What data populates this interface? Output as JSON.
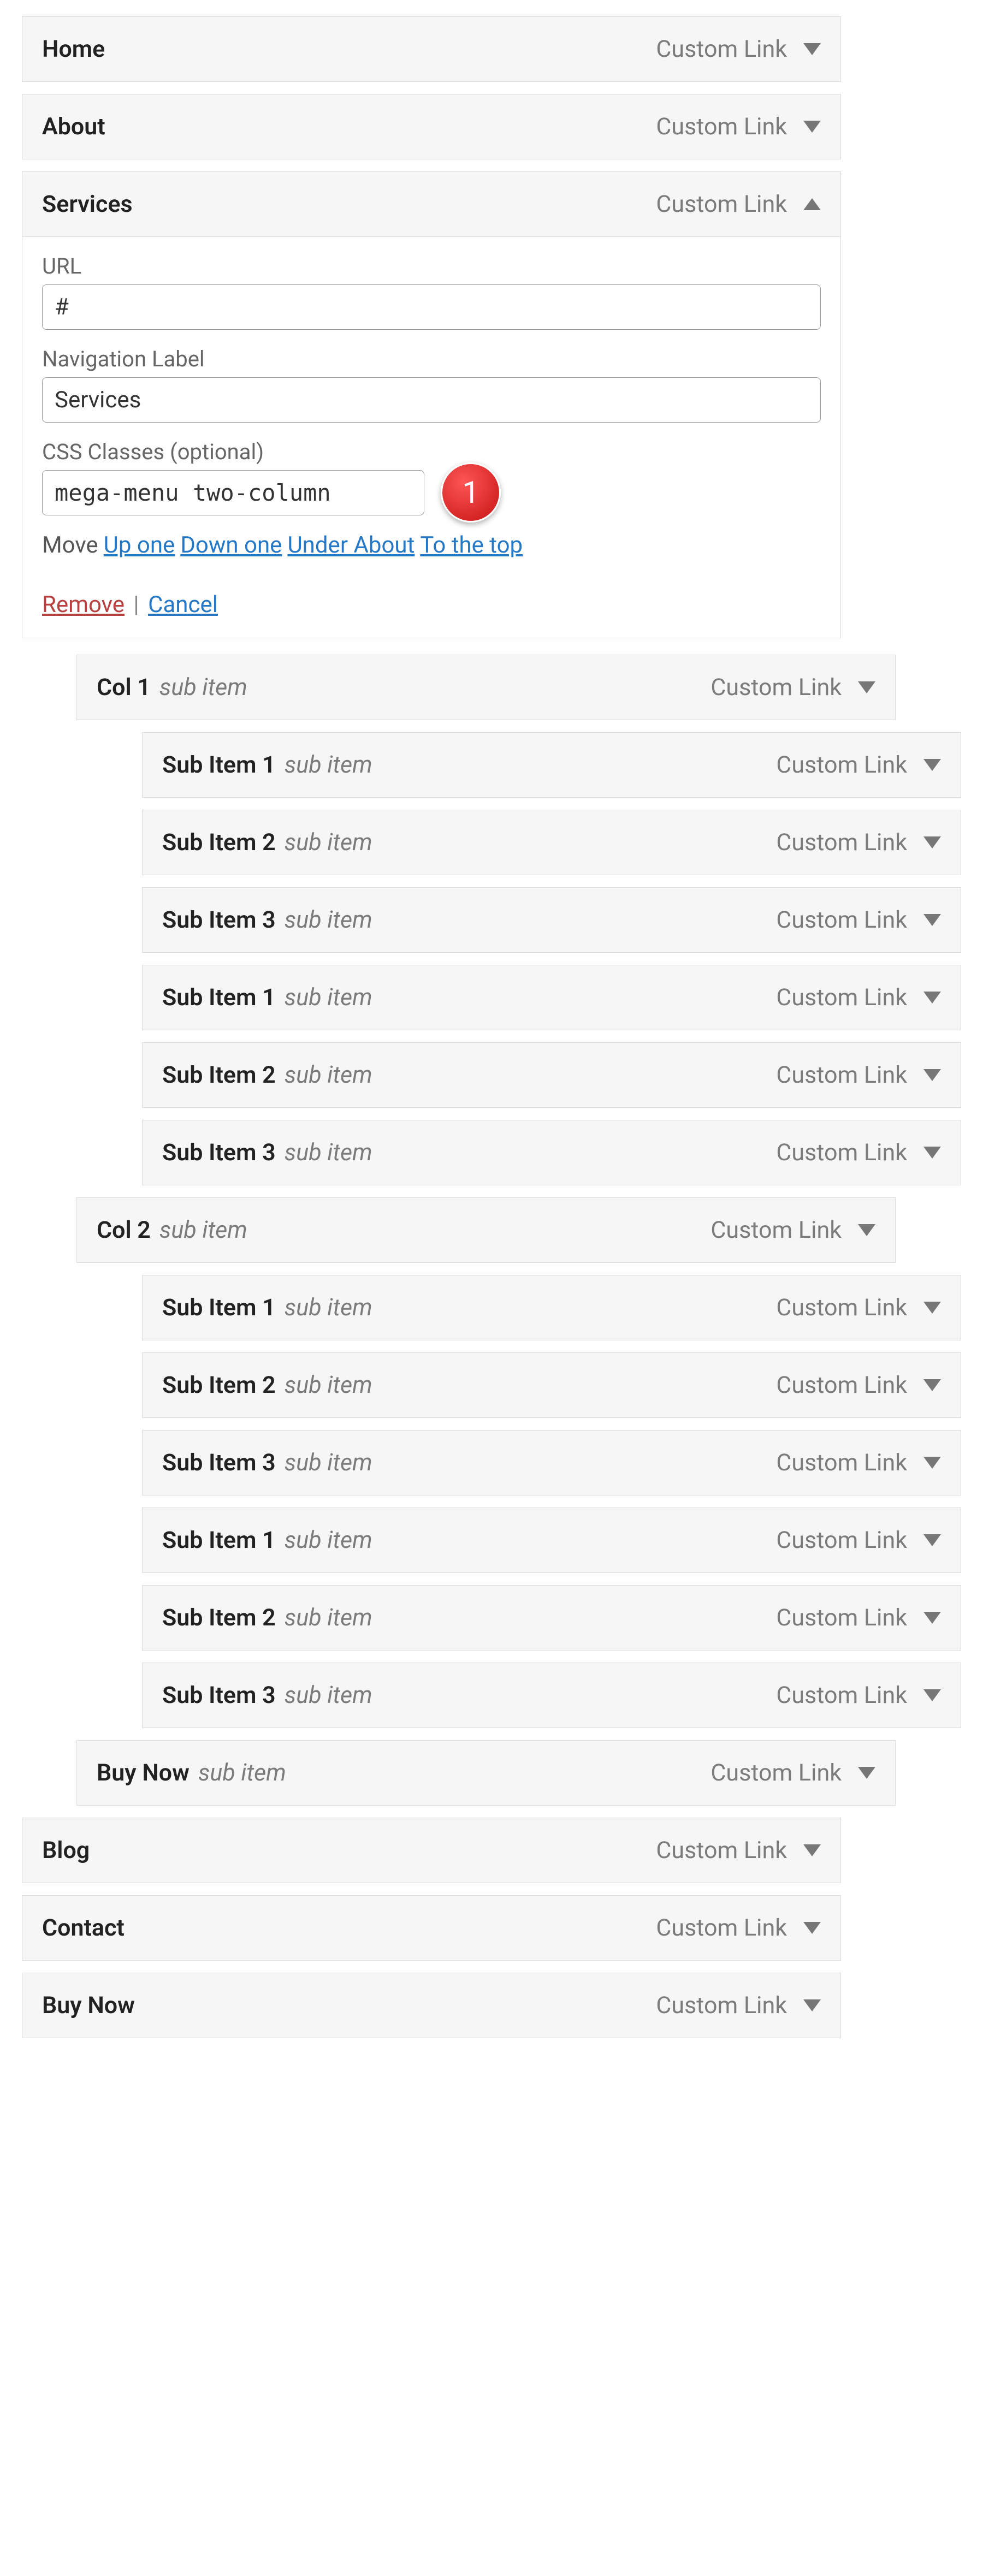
{
  "callouts": {
    "c1": "1"
  },
  "labels": {
    "url": "URL",
    "navLabel": "Navigation Label",
    "cssClasses": "CSS Classes (optional)",
    "move": "Move",
    "upOne": "Up one",
    "downOne": "Down one",
    "underAbout": "Under About",
    "toTop": "To the top",
    "remove": "Remove",
    "sep": " | ",
    "cancel": "Cancel",
    "customLink": "Custom Link",
    "subItem": "sub item"
  },
  "expanded": {
    "title": "Services",
    "url": "#",
    "navValue": "Services",
    "cssValue": "mega-menu two-column"
  },
  "items": [
    {
      "depth": 0,
      "title": "Home",
      "sub": "",
      "open": false
    },
    {
      "depth": 0,
      "title": "About",
      "sub": "",
      "open": false
    },
    {
      "depth": 0,
      "title": "Services",
      "sub": "",
      "open": true
    },
    {
      "depth": 1,
      "title": "Col 1",
      "sub": "sub item",
      "open": false
    },
    {
      "depth": 2,
      "title": "Sub Item 1",
      "sub": "sub item",
      "open": false
    },
    {
      "depth": 2,
      "title": "Sub Item 2",
      "sub": "sub item",
      "open": false
    },
    {
      "depth": 2,
      "title": "Sub Item 3",
      "sub": "sub item",
      "open": false
    },
    {
      "depth": 2,
      "title": "Sub Item 1",
      "sub": "sub item",
      "open": false
    },
    {
      "depth": 2,
      "title": "Sub Item 2",
      "sub": "sub item",
      "open": false
    },
    {
      "depth": 2,
      "title": "Sub Item 3",
      "sub": "sub item",
      "open": false
    },
    {
      "depth": 1,
      "title": "Col 2",
      "sub": "sub item",
      "open": false
    },
    {
      "depth": 2,
      "title": "Sub Item 1",
      "sub": "sub item",
      "open": false
    },
    {
      "depth": 2,
      "title": "Sub Item 2",
      "sub": "sub item",
      "open": false
    },
    {
      "depth": 2,
      "title": "Sub Item 3",
      "sub": "sub item",
      "open": false
    },
    {
      "depth": 2,
      "title": "Sub Item 1",
      "sub": "sub item",
      "open": false
    },
    {
      "depth": 2,
      "title": "Sub Item 2",
      "sub": "sub item",
      "open": false
    },
    {
      "depth": 2,
      "title": "Sub Item 3",
      "sub": "sub item",
      "open": false
    },
    {
      "depth": 1,
      "title": "Buy Now",
      "sub": "sub item",
      "open": false
    },
    {
      "depth": 0,
      "title": "Blog",
      "sub": "",
      "open": false
    },
    {
      "depth": 0,
      "title": "Contact",
      "sub": "",
      "open": false
    },
    {
      "depth": 0,
      "title": "Buy Now",
      "sub": "",
      "open": false
    }
  ]
}
